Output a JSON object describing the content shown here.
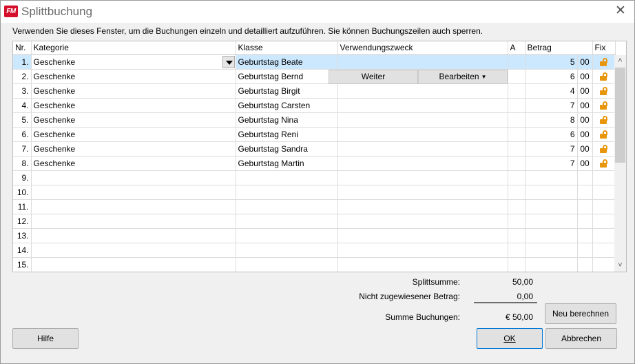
{
  "window": {
    "app_icon_text": "FM",
    "title": "Splittbuchung",
    "close_label": "✕"
  },
  "intro_text": "Verwenden Sie dieses Fenster, um die Buchungen einzeln und detailliert aufzuführen. Sie können Buchungszeilen auch sperren.",
  "grid": {
    "columns": {
      "nr": "Nr.",
      "kategorie": "Kategorie",
      "klasse": "Klasse",
      "verwendungszweck": "Verwendungszweck",
      "a": "A",
      "betrag": "Betrag",
      "fix": "Fix"
    },
    "rows": [
      {
        "nr": "1.",
        "kategorie": "Geschenke",
        "klasse": "Geburtstag Beate",
        "verwendungszweck": "",
        "a": "",
        "betrag": "5",
        "cents": "00",
        "locked": false
      },
      {
        "nr": "2.",
        "kategorie": "Geschenke",
        "klasse": "Geburtstag Bernd",
        "verwendungszweck": "",
        "a": "",
        "betrag": "6",
        "cents": "00",
        "locked": false
      },
      {
        "nr": "3.",
        "kategorie": "Geschenke",
        "klasse": "Geburtstag Birgit",
        "verwendungszweck": "",
        "a": "",
        "betrag": "4",
        "cents": "00",
        "locked": false
      },
      {
        "nr": "4.",
        "kategorie": "Geschenke",
        "klasse": "Geburtstag Carsten",
        "verwendungszweck": "",
        "a": "",
        "betrag": "7",
        "cents": "00",
        "locked": false
      },
      {
        "nr": "5.",
        "kategorie": "Geschenke",
        "klasse": "Geburtstag Nina",
        "verwendungszweck": "",
        "a": "",
        "betrag": "8",
        "cents": "00",
        "locked": false
      },
      {
        "nr": "6.",
        "kategorie": "Geschenke",
        "klasse": "Geburtstag Reni",
        "verwendungszweck": "",
        "a": "",
        "betrag": "6",
        "cents": "00",
        "locked": false
      },
      {
        "nr": "7.",
        "kategorie": "Geschenke",
        "klasse": "Geburtstag Sandra",
        "verwendungszweck": "",
        "a": "",
        "betrag": "7",
        "cents": "00",
        "locked": false
      },
      {
        "nr": "8.",
        "kategorie": "Geschenke",
        "klasse": "Geburtstag Martin",
        "verwendungszweck": "",
        "a": "",
        "betrag": "7",
        "cents": "00",
        "locked": false
      },
      {
        "nr": "9.",
        "kategorie": "",
        "klasse": "",
        "verwendungszweck": "",
        "a": "",
        "betrag": "",
        "cents": "",
        "locked": null
      },
      {
        "nr": "10.",
        "kategorie": "",
        "klasse": "",
        "verwendungszweck": "",
        "a": "",
        "betrag": "",
        "cents": "",
        "locked": null
      },
      {
        "nr": "11.",
        "kategorie": "",
        "klasse": "",
        "verwendungszweck": "",
        "a": "",
        "betrag": "",
        "cents": "",
        "locked": null
      },
      {
        "nr": "12.",
        "kategorie": "",
        "klasse": "",
        "verwendungszweck": "",
        "a": "",
        "betrag": "",
        "cents": "",
        "locked": null
      },
      {
        "nr": "13.",
        "kategorie": "",
        "klasse": "",
        "verwendungszweck": "",
        "a": "",
        "betrag": "",
        "cents": "",
        "locked": null
      },
      {
        "nr": "14.",
        "kategorie": "",
        "klasse": "",
        "verwendungszweck": "",
        "a": "",
        "betrag": "",
        "cents": "",
        "locked": null
      },
      {
        "nr": "15.",
        "kategorie": "",
        "klasse": "",
        "verwendungszweck": "",
        "a": "",
        "betrag": "",
        "cents": "",
        "locked": null
      }
    ],
    "selected_row": 0,
    "inline_buttons": {
      "weiter": "Weiter",
      "bearbeiten": "Bearbeiten"
    }
  },
  "summary": {
    "splitsumme_label": "Splittsumme:",
    "splitsumme_value": "50,00",
    "nicht_zugewiesen_label": "Nicht zugewiesener Betrag:",
    "nicht_zugewiesen_value": "0,00",
    "summe_label": "Summe Buchungen:",
    "summe_value": "€ 50,00"
  },
  "buttons": {
    "neu_berechnen": "Neu berechnen",
    "hilfe": "Hilfe",
    "ok": "OK",
    "abbrechen": "Abbrechen"
  },
  "colors": {
    "selected_row": "#cce8ff",
    "lock_icon": "#e8960c",
    "app_icon": "#d4102a"
  },
  "icons": {
    "app": "fm-logo-icon",
    "close": "close-icon",
    "dropdown": "chevron-down-icon",
    "lock": "unlocked-padlock-icon",
    "scroll_up": "chevron-up-icon",
    "scroll_down": "chevron-down-icon"
  }
}
